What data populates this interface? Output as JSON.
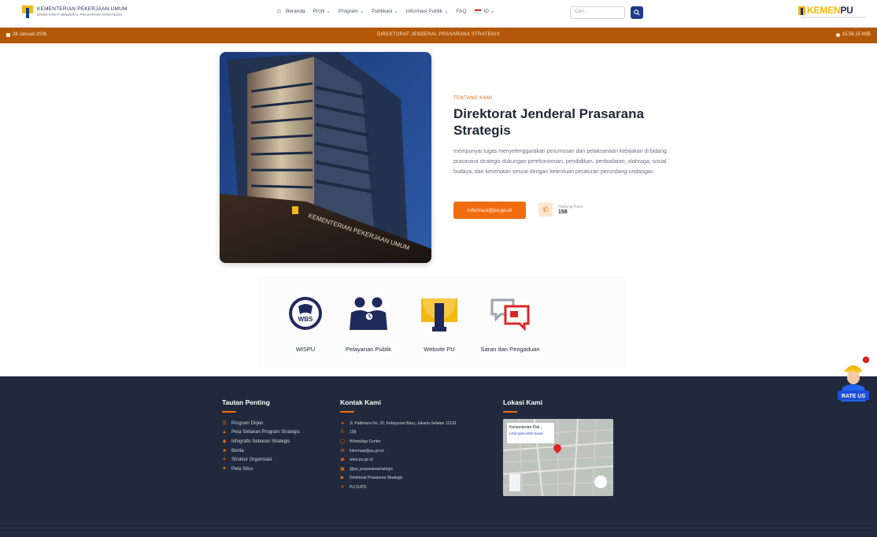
{
  "header": {
    "brand_line1": "KEMENTERIAN PEKERJAAN UMUM",
    "brand_line2": "DIREKTORAT JENDERAL PRASARANA STRATEGIS",
    "nav": [
      {
        "label": "Beranda"
      },
      {
        "label": "Profil"
      },
      {
        "label": "Program"
      },
      {
        "label": "Publikasi"
      },
      {
        "label": "Informasi Publik"
      },
      {
        "label": "FAQ"
      },
      {
        "label": "ID"
      }
    ],
    "search_placeholder": "Cari...",
    "logo_k1": "KEMEN",
    "logo_k2": "PU"
  },
  "infobar": {
    "date": "28 Januari 2026",
    "title": "DIREKTORAT JENDERAL PRASARANA STRATEGIS",
    "time": "15.56.15 WIB"
  },
  "hero": {
    "building_sign": "KEMENTERIAN PEKERJAAN UMUM",
    "label": "TENTANG KAMI",
    "title": "Direktorat Jenderal Prasarana Strategis",
    "description": "mempunyai tugas menyelenggarakan perumusan dan pelaksanaan kebijakan di bidang prasarana strategis dukungan perekonomian, pendidikan, peribadatan, olahraga, sosial budaya, dan kesehatan sesuai dengan ketentuan peraturan perundang-undangan.",
    "email_button": "informasi@pu.go.id",
    "call_label": "Hubungi Kami",
    "call_number": "158"
  },
  "services": [
    {
      "label": "WISPU",
      "icon": "wbs-icon"
    },
    {
      "label": "Pelayanan Publik",
      "icon": "people-icon"
    },
    {
      "label": "Website PU",
      "icon": "pu-logo-icon"
    },
    {
      "label": "Saran dan Pengaduan",
      "icon": "chat-icon"
    }
  ],
  "footer": {
    "links_title": "Tautan Penting",
    "links": [
      "Program Dirjen",
      "Peta Sebaran Program Strategis",
      "Infografis Sebaran Strategis",
      "Berita",
      "Struktur Organisasi",
      "Peta Situs"
    ],
    "contact_title": "Kontak Kami",
    "contacts": [
      "Jl. Pattimura No. 20, Kebayoran Baru, Jakarta Selatan 12110",
      "158",
      "WhatsApp Center",
      "informasi@pu.go.id",
      "www.pu.go.id",
      "@pu_prasaranastrategis",
      "Direktorat Prasarana Strategis",
      "PU DJPS"
    ],
    "location_title": "Lokasi Kami",
    "map_name": "Kementerian Pek...",
    "map_link": "Lihat peta lebih besar"
  },
  "rateus": {
    "label": "RATE US"
  },
  "colors": {
    "accent": "#f06d0f",
    "infobar": "#b35808",
    "footer": "#202a3c",
    "brand_blue": "#1f2a5c",
    "brand_yellow": "#f2b90f"
  }
}
